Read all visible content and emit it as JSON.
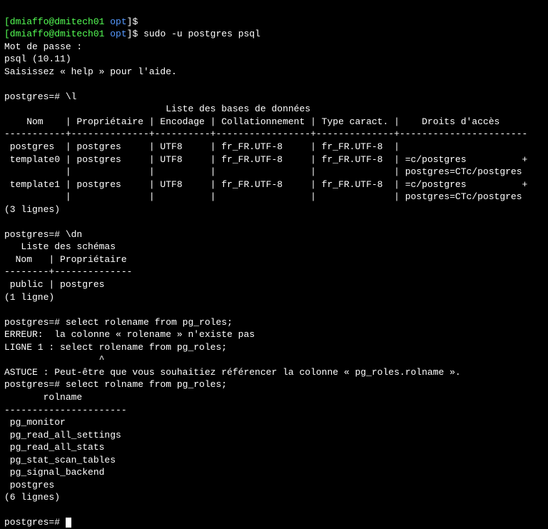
{
  "prompt": {
    "user_host": "[dmiaffo@dmitech01",
    "path": "opt",
    "suffix": "]$"
  },
  "line_empty_cmd": " ",
  "cmd_sudo": " sudo -u postgres psql",
  "password_prompt": "Mot de passe :",
  "psql_version": "psql (10.11)",
  "help_hint": "Saisissez « help » pour l'aide.",
  "blank": "",
  "pg_prompt": "postgres=# ",
  "cmd_l": "\\l",
  "db_list": {
    "title": "                             Liste des bases de données",
    "header": "    Nom    | Propriétaire | Encodage | Collationnement | Type caract. |    Droits d'accès",
    "sep": "-----------+--------------+----------+-----------------+--------------+-----------------------",
    "rows": [
      " postgres  | postgres     | UTF8     | fr_FR.UTF-8     | fr_FR.UTF-8  |",
      " template0 | postgres     | UTF8     | fr_FR.UTF-8     | fr_FR.UTF-8  | =c/postgres          +",
      "           |              |          |                 |              | postgres=CTc/postgres",
      " template1 | postgres     | UTF8     | fr_FR.UTF-8     | fr_FR.UTF-8  | =c/postgres          +",
      "           |              |          |                 |              | postgres=CTc/postgres"
    ],
    "count": "(3 lignes)"
  },
  "cmd_dn": "\\dn",
  "schema_list": {
    "title": "   Liste des schémas",
    "header": "  Nom   | Propriétaire",
    "sep": "--------+--------------",
    "row": " public | postgres",
    "count": "(1 ligne)"
  },
  "cmd_sel_bad": "select rolename from pg_roles;",
  "error": "ERREUR:  la colonne « rolename » n'existe pas",
  "error_line": "LIGNE 1 : select rolename from pg_roles;",
  "error_caret": "                 ^",
  "hint": "ASTUCE : Peut-être que vous souhaitiez référencer la colonne « pg_roles.rolname ».",
  "cmd_sel_good": "select rolname from pg_roles;",
  "roles": {
    "header": "       rolname",
    "sep": "----------------------",
    "rows": [
      " pg_monitor",
      " pg_read_all_settings",
      " pg_read_all_stats",
      " pg_stat_scan_tables",
      " pg_signal_backend",
      " postgres"
    ],
    "count": "(6 lignes)"
  }
}
